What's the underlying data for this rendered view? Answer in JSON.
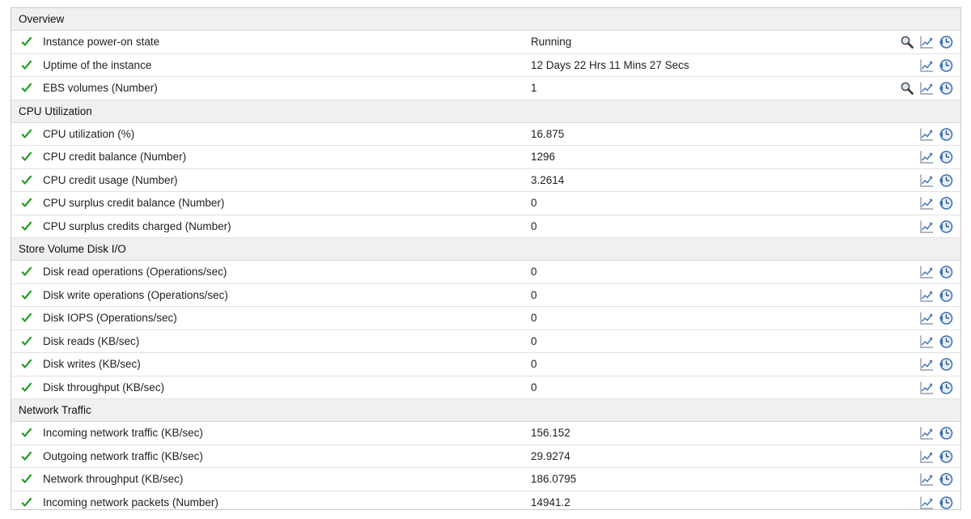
{
  "sections": [
    {
      "title": "Overview",
      "rows": [
        {
          "label": "Instance power-on state",
          "value": "Running",
          "search": true
        },
        {
          "label": "Uptime of the instance",
          "value": "12 Days 22 Hrs 11 Mins 27 Secs",
          "search": false
        },
        {
          "label": "EBS volumes (Number)",
          "value": "1",
          "search": true
        }
      ]
    },
    {
      "title": "CPU Utilization",
      "rows": [
        {
          "label": "CPU utilization (%)",
          "value": "16.875",
          "search": false
        },
        {
          "label": "CPU credit balance (Number)",
          "value": "1296",
          "search": false
        },
        {
          "label": "CPU credit usage (Number)",
          "value": "3.2614",
          "search": false
        },
        {
          "label": "CPU surplus credit balance (Number)",
          "value": "0",
          "search": false
        },
        {
          "label": "CPU surplus credits charged (Number)",
          "value": "0",
          "search": false
        }
      ]
    },
    {
      "title": "Store Volume Disk I/O",
      "rows": [
        {
          "label": "Disk read operations (Operations/sec)",
          "value": "0",
          "search": false
        },
        {
          "label": "Disk write operations (Operations/sec)",
          "value": "0",
          "search": false
        },
        {
          "label": "Disk IOPS (Operations/sec)",
          "value": "0",
          "search": false
        },
        {
          "label": "Disk reads (KB/sec)",
          "value": "0",
          "search": false
        },
        {
          "label": "Disk writes (KB/sec)",
          "value": "0",
          "search": false
        },
        {
          "label": "Disk throughput (KB/sec)",
          "value": "0",
          "search": false
        }
      ]
    },
    {
      "title": "Network Traffic",
      "rows": [
        {
          "label": "Incoming network traffic (KB/sec)",
          "value": "156.152",
          "search": false
        },
        {
          "label": "Outgoing network traffic (KB/sec)",
          "value": "29.9274",
          "search": false
        },
        {
          "label": "Network throughput (KB/sec)",
          "value": "186.0795",
          "search": false
        },
        {
          "label": "Incoming network packets (Number)",
          "value": "14941.2",
          "search": false
        }
      ]
    }
  ],
  "icons": {
    "status": "check-icon",
    "search": "magnifier-icon",
    "graph": "line-graph-icon",
    "history": "history-clock-icon"
  },
  "colors": {
    "status_ok": "#1a9a1a",
    "graph_icon": "#4a78b5",
    "history_icon": "#3d6fb0",
    "section_bg": "#f0f0f0"
  }
}
